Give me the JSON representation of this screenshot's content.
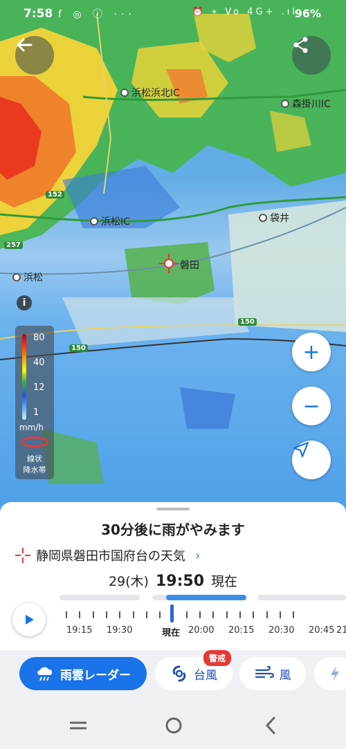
{
  "status_bar": {
    "time": "7:58",
    "left_icons": "f ◎ ⓘ ···",
    "right_icons": "⏰ ⌖ Vo 4G+ .ıl",
    "battery": "96%"
  },
  "map": {
    "places": [
      {
        "name": "浜松浜北IC"
      },
      {
        "name": "森掛川IC"
      },
      {
        "name": "浜松IC"
      },
      {
        "name": "袋井"
      },
      {
        "name": "磐田"
      },
      {
        "name": "浜松"
      }
    ],
    "roads": [
      "152",
      "257",
      "150",
      "150"
    ],
    "colors": {
      "heavy_rain": "#ff2800",
      "moderate": "#ffd400",
      "light": "#3ab03a",
      "drizzle": "#58a8ff"
    }
  },
  "legend": {
    "values": [
      "80",
      "40",
      "12",
      "1"
    ],
    "unit": "mm/h",
    "band_label_1": "線状",
    "band_label_2": "降水帯"
  },
  "controls": {
    "back_icon": "arrow-left-icon",
    "share_icon": "share-icon",
    "zoom_in": "+",
    "zoom_out": "−",
    "info": "i"
  },
  "sheet": {
    "headline": "30分後に雨がやみます",
    "location": "静岡県磐田市国府台の天気",
    "date": "29(木)",
    "clock": "19:50",
    "now_label": "現在",
    "progress": 0.5,
    "time_labels": [
      "19:15",
      "19:30",
      "現在",
      "20:00",
      "20:15",
      "20:30",
      "20:45",
      "21"
    ]
  },
  "tabs": [
    {
      "label": "雨雲レーダー",
      "icon": "rain-cloud-icon"
    },
    {
      "label": "台風",
      "icon": "typhoon-icon",
      "badge": "警戒"
    },
    {
      "label": "風",
      "icon": "wind-icon"
    },
    {
      "label": "",
      "icon": "lightning-icon"
    }
  ],
  "accent": "#1a73e8"
}
